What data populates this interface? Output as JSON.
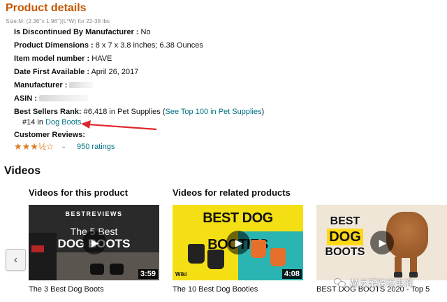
{
  "product_details": {
    "title": "Product details",
    "size_line": "Size:M: (2.36''x 1.96'')(L*W) for 22-38 lbs",
    "rows": [
      {
        "key": "Is Discontinued By Manufacturer :",
        "value": "No"
      },
      {
        "key": "Product Dimensions :",
        "value": "8 x 7 x 3.8 inches; 6.38 Ounces"
      },
      {
        "key": "Item model number :",
        "value": "HAVE"
      },
      {
        "key": "Date First Available :",
        "value": "April 26, 2017"
      },
      {
        "key": "Manufacturer :",
        "value": ""
      },
      {
        "key": "ASIN :",
        "value": ""
      }
    ],
    "best_sellers": {
      "key": "Best Sellers Rank:",
      "rank_text": "#6,418 in Pet Supplies (",
      "top100_link": "See Top 100 in Pet Supplies",
      "rank_close": ")",
      "sub_rank": "#14 in ",
      "sub_link": "Dog Boots"
    },
    "reviews": {
      "label": "Customer Reviews:",
      "rating_stars": 3.5,
      "star_glyphs": "★★★½☆",
      "chevron": "⌄",
      "ratings_link": "950 ratings"
    }
  },
  "videos": {
    "heading": "Videos",
    "product_section_title": "Videos for this product",
    "related_section_title": "Videos for related products",
    "prev_button": "‹",
    "cards": [
      {
        "thumb_brand": "BESTREVIEWS",
        "thumb_line1": "The 5 Best",
        "thumb_line2": "DOG BOOTS",
        "duration": "3:59",
        "caption": "The 3 Best Dog Boots"
      },
      {
        "thumb_headline": "BEST DOG BOOTIES",
        "thumb_corner": "Wiki",
        "duration": "4:08",
        "caption": "The 10 Best Dog Booties"
      },
      {
        "thumb_word1": "BEST",
        "thumb_word2": "DOG",
        "thumb_word3": "BOOTS",
        "duration": "",
        "caption": "BEST DOG BOOTS 2020 - Top 5"
      }
    ]
  },
  "watermark": {
    "text": "赫龙蕃跨境电商"
  },
  "colors": {
    "title_orange": "#c45500",
    "link_teal": "#007185",
    "star": "#de7921",
    "arrow_red": "#e0262b"
  }
}
